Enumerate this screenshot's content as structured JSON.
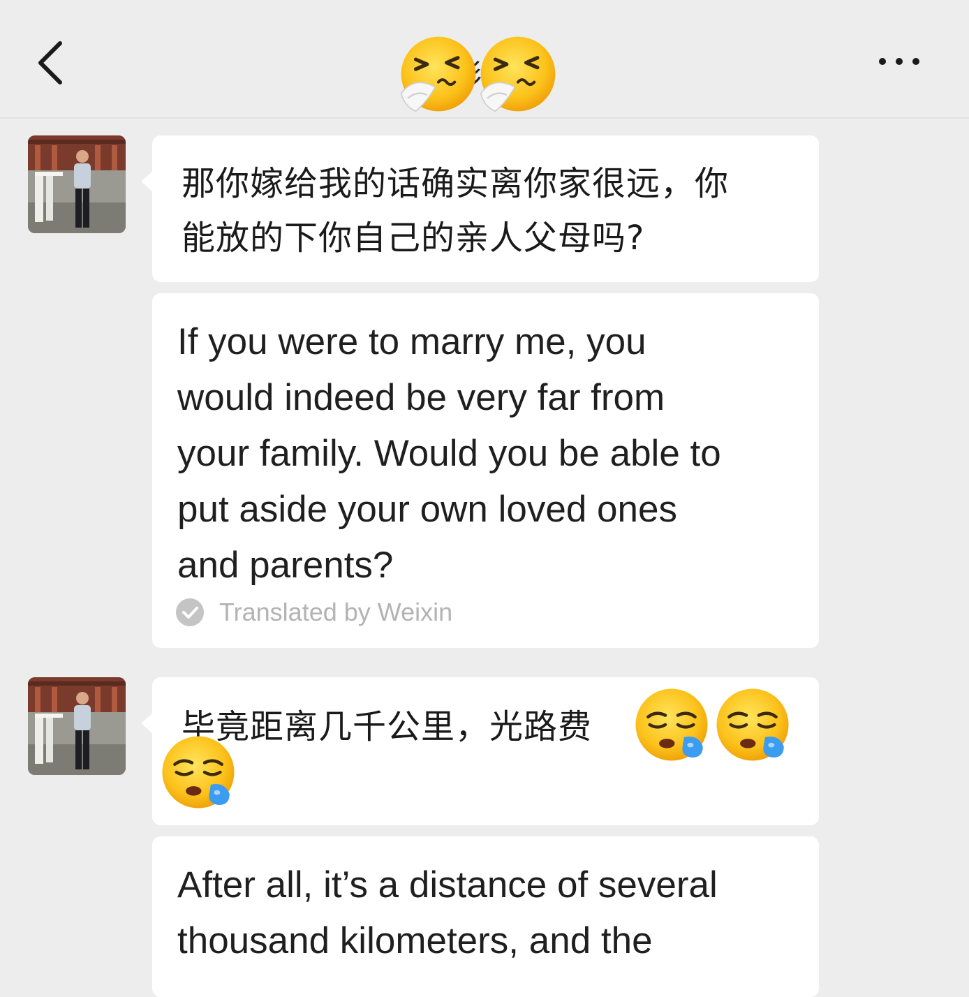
{
  "header": {
    "title": "彩彩",
    "back_icon": "chevron-left-icon",
    "more_icon": "ellipsis-icon",
    "title_emojis": [
      "sneezing-face-emoji",
      "sneezing-face-emoji"
    ]
  },
  "messages": [
    {
      "sender": "contact",
      "original": "那你嫁给我的话确实离你家很远，你能放的下你自己的亲人父母吗?",
      "original_lines": [
        "那你嫁给我的话确实离你家很远，你",
        "能放的下你自己的亲人父母吗?"
      ],
      "translation_lines": [
        "If you were to marry me, you",
        "would indeed be very far from",
        "your family. Would you be able to",
        "put aside your own loved ones",
        "and parents?"
      ],
      "translated_by": "Translated by Weixin"
    },
    {
      "sender": "contact",
      "original_lines": [
        "毕竟距离几千公里，光路费"
      ],
      "emojis": [
        "sleepy-face-emoji",
        "sleepy-face-emoji",
        "sleepy-face-emoji"
      ],
      "translation_lines": [
        "After all, it’s a distance of several",
        "thousand kilometers, and the"
      ]
    }
  ],
  "colors": {
    "background": "#ededed",
    "bubble": "#ffffff",
    "muted_text": "#b3b3b3"
  }
}
